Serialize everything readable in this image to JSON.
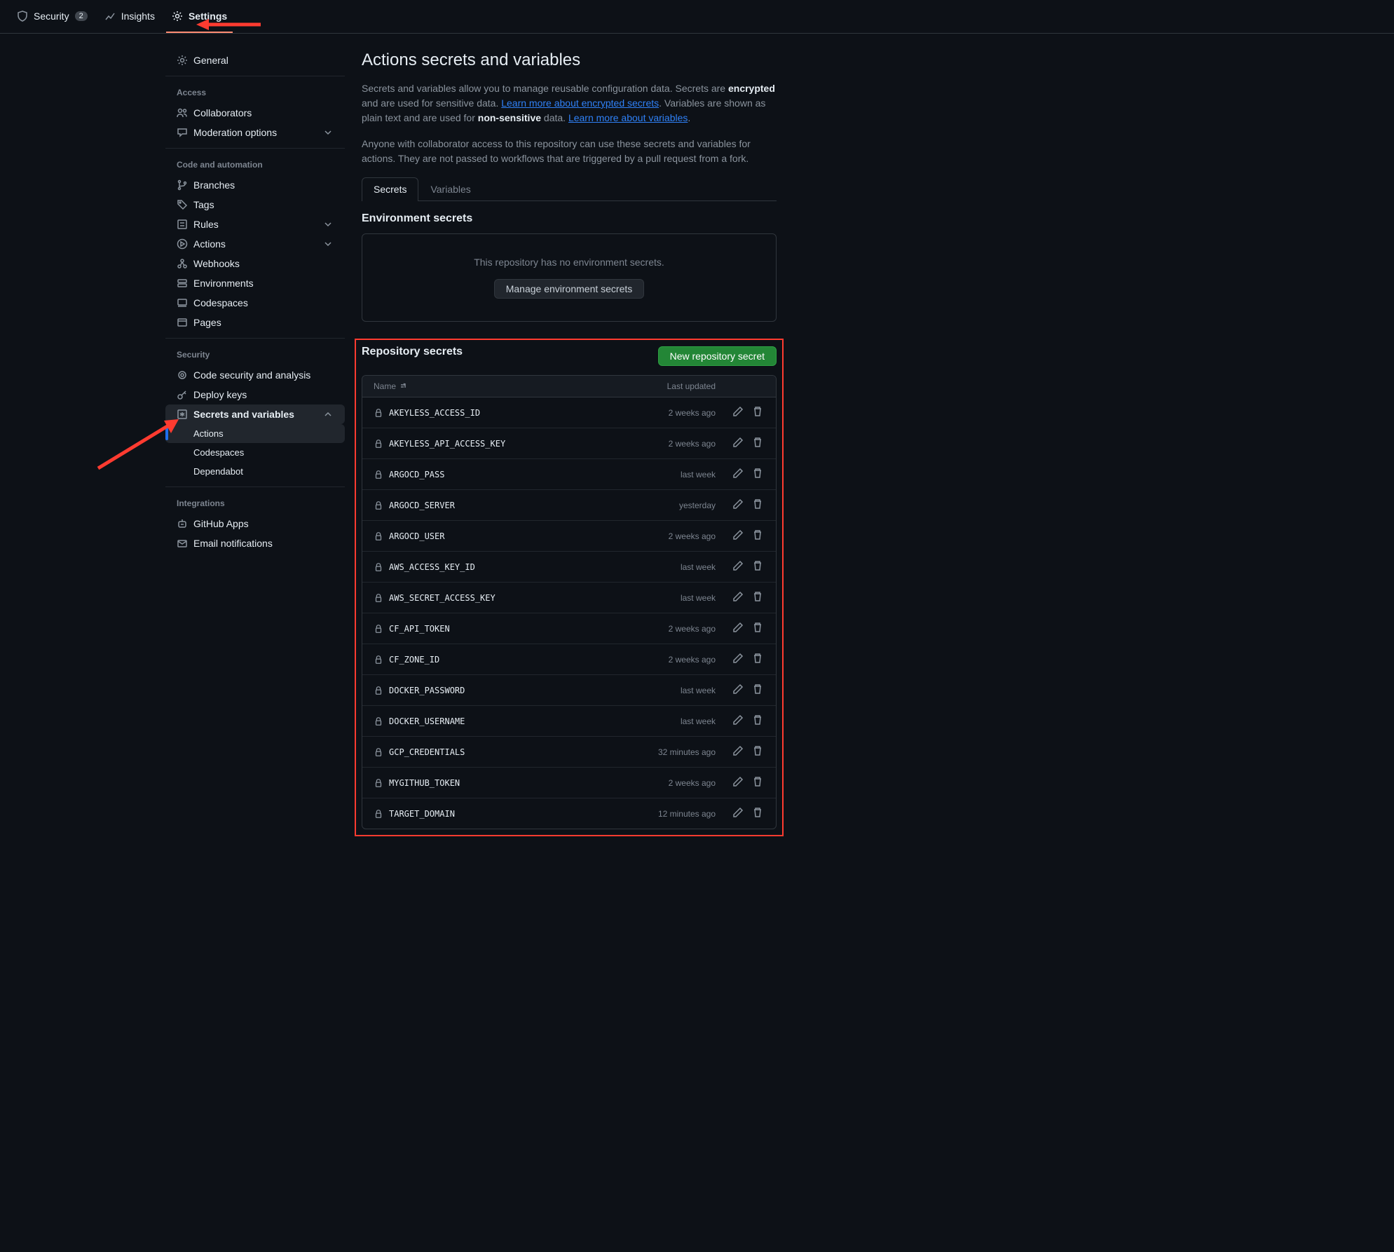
{
  "topnav": {
    "security": {
      "label": "Security",
      "badge": "2"
    },
    "insights": {
      "label": "Insights"
    },
    "settings": {
      "label": "Settings"
    }
  },
  "sidebar": {
    "general": "General",
    "sections": {
      "access": {
        "title": "Access",
        "items": {
          "collaborators": "Collaborators",
          "moderation": "Moderation options"
        }
      },
      "code": {
        "title": "Code and automation",
        "items": {
          "branches": "Branches",
          "tags": "Tags",
          "rules": "Rules",
          "actions": "Actions",
          "webhooks": "Webhooks",
          "environments": "Environments",
          "codespaces": "Codespaces",
          "pages": "Pages"
        }
      },
      "security": {
        "title": "Security",
        "items": {
          "codesec": "Code security and analysis",
          "deploykeys": "Deploy keys",
          "secretsvars": "Secrets and variables",
          "sub_actions": "Actions",
          "sub_codespaces": "Codespaces",
          "sub_dependabot": "Dependabot"
        }
      },
      "integrations": {
        "title": "Integrations",
        "items": {
          "ghapps": "GitHub Apps",
          "email": "Email notifications"
        }
      }
    }
  },
  "main": {
    "title": "Actions secrets and variables",
    "desc_part1": "Secrets and variables allow you to manage reusable configuration data. Secrets are ",
    "desc_encrypted": "encrypted",
    "desc_part2": " and are used for sensitive data. ",
    "desc_link1": "Learn more about encrypted secrets",
    "desc_part3": ". Variables are shown as plain text and are used for ",
    "desc_nonsensitive": "non-sensitive",
    "desc_part4": " data. ",
    "desc_link2": "Learn more about variables",
    "desc_part5": ".",
    "desc2": "Anyone with collaborator access to this repository can use these secrets and variables for actions. They are not passed to workflows that are triggered by a pull request from a fork.",
    "tabs": {
      "secrets": "Secrets",
      "variables": "Variables"
    },
    "env": {
      "title": "Environment secrets",
      "empty": "This repository has no environment secrets.",
      "button": "Manage environment secrets"
    },
    "repo": {
      "title": "Repository secrets",
      "button": "New repository secret",
      "col_name": "Name",
      "col_updated": "Last updated"
    }
  },
  "secrets": [
    {
      "name": "AKEYLESS_ACCESS_ID",
      "updated": "2 weeks ago"
    },
    {
      "name": "AKEYLESS_API_ACCESS_KEY",
      "updated": "2 weeks ago"
    },
    {
      "name": "ARGOCD_PASS",
      "updated": "last week"
    },
    {
      "name": "ARGOCD_SERVER",
      "updated": "yesterday"
    },
    {
      "name": "ARGOCD_USER",
      "updated": "2 weeks ago"
    },
    {
      "name": "AWS_ACCESS_KEY_ID",
      "updated": "last week"
    },
    {
      "name": "AWS_SECRET_ACCESS_KEY",
      "updated": "last week"
    },
    {
      "name": "CF_API_TOKEN",
      "updated": "2 weeks ago"
    },
    {
      "name": "CF_ZONE_ID",
      "updated": "2 weeks ago"
    },
    {
      "name": "DOCKER_PASSWORD",
      "updated": "last week"
    },
    {
      "name": "DOCKER_USERNAME",
      "updated": "last week"
    },
    {
      "name": "GCP_CREDENTIALS",
      "updated": "32 minutes ago"
    },
    {
      "name": "MYGITHUB_TOKEN",
      "updated": "2 weeks ago"
    },
    {
      "name": "TARGET_DOMAIN",
      "updated": "12 minutes ago"
    }
  ]
}
